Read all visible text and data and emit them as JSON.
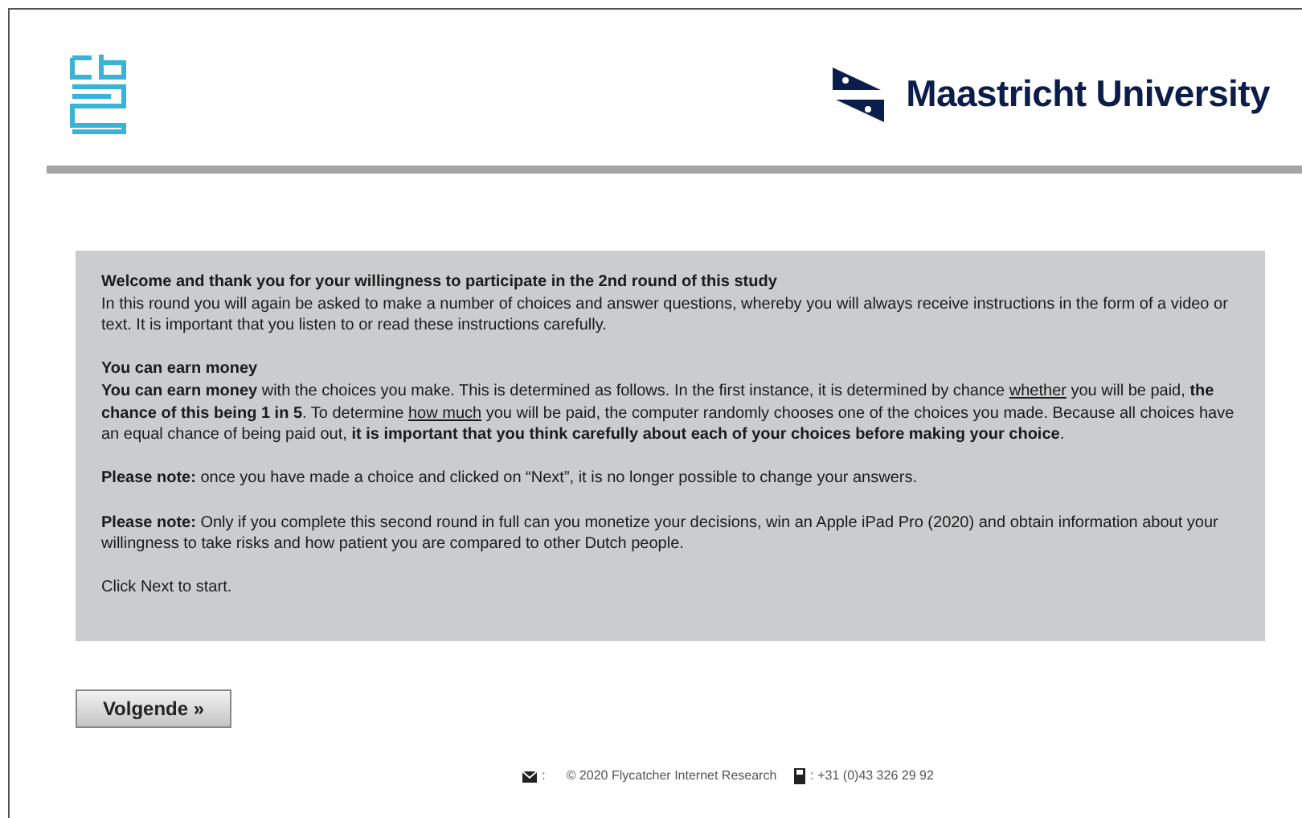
{
  "header": {
    "university_name": "Maastricht University"
  },
  "intro": {
    "blocks": [
      [
        {
          "segments": [
            {
              "kind": "plain",
              "text": "**Welcome and thank you for your willingness to participate in the 2nd round of this study**"
            }
          ]
        },
        {
          "segments": [
            {
              "kind": "plain",
              "text": "In this round you will again be asked to make a number of choices and answer questions, whereby you will always receive instructions in the form of a video or text. It is important that you listen to or read these instructions carefully."
            }
          ]
        }
      ],
      [
        {
          "segments": [
            {
              "kind": "plain",
              "text": "**You can earn money**"
            }
          ]
        },
        {
          "segments": [
            {
              "kind": "plain",
              "text": "**You can earn money** with the choices you make. This is determined as follows. In the first instance, it is determined by chance "
            },
            {
              "kind": "underlined",
              "text": "whether"
            },
            {
              "kind": "plain",
              "text": " you will be paid, **the chance of this being 1 in 5**. To determine "
            },
            {
              "kind": "underlined",
              "text": "how much"
            },
            {
              "kind": "plain",
              "text": " you will be paid, the computer randomly chooses one of the choices you made. Because all choices have an equal chance of being paid out, **it is important that you think carefully about each of your choices before making your choice**."
            }
          ]
        }
      ],
      [
        {
          "segments": [
            {
              "kind": "plain",
              "text": "**Please note:** once you have made a choice and clicked on “Next”, it is no longer possible to change your answers."
            }
          ]
        }
      ],
      [
        {
          "segments": [
            {
              "kind": "plain",
              "text": "**Please note:** Only if you complete this second round in full can you monetize your decisions, win an Apple iPad Pro (2020) and obtain information about your willingness to take risks and how patient you are compared to other Dutch people."
            }
          ]
        }
      ],
      [
        {
          "segments": [
            {
              "kind": "plain",
              "text": "Click Next to start."
            }
          ]
        }
      ]
    ]
  },
  "next_button": "Volgende »",
  "footer": {
    "email_separator": ":",
    "copyright": "© 2020 Flycatcher Internet Research",
    "phone": ": +31 (0)43 326 29 92"
  }
}
